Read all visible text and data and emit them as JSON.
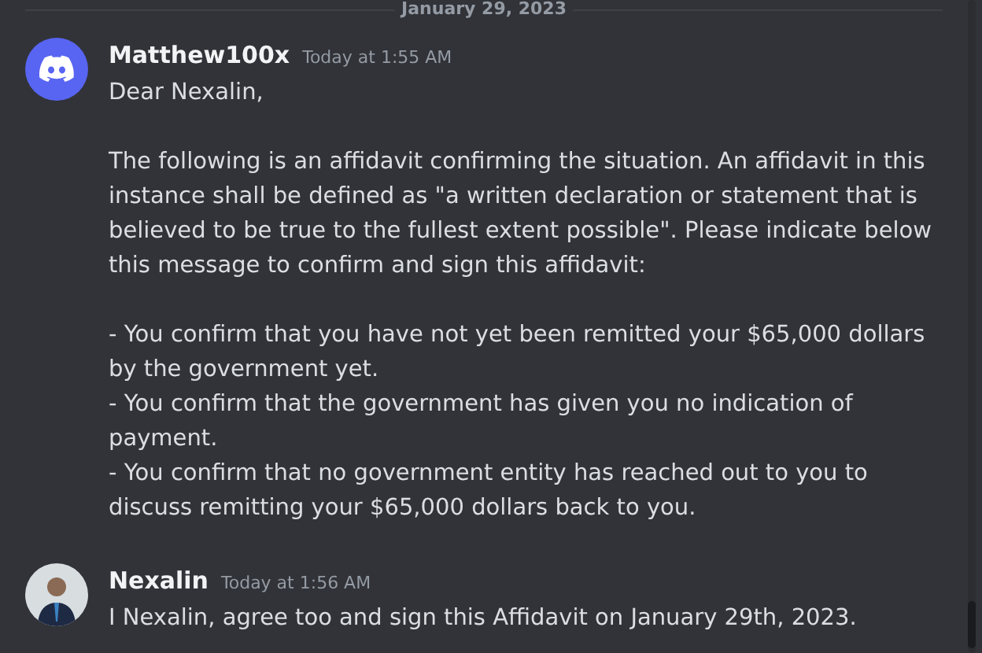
{
  "date_divider": "January 29, 2023",
  "messages": [
    {
      "author": "Matthew100x",
      "timestamp": "Today at 1:55 AM",
      "avatar": {
        "kind": "logo"
      },
      "blocks": [
        [
          "Dear Nexalin,"
        ],
        [
          "The following is an affidavit confirming the situation. An affidavit in this instance shall be defined as \"a written declaration or statement that is believed to be true to the fullest extent possible\". Please indicate below this message to confirm and sign this affidavit:"
        ],
        [
          "- You confirm that you have not yet been remitted your $65,000 dollars by the government yet.",
          "- You confirm that the government has given you no indication of payment.",
          "- You confirm that no government entity has reached out to you to discuss remitting your $65,000 dollars back to you."
        ]
      ]
    },
    {
      "author": "Nexalin",
      "timestamp": "Today at 1:56 AM",
      "avatar": {
        "kind": "photo"
      },
      "blocks": [
        [
          "I Nexalin, agree too and sign this Affidavit on January 29th, 2023."
        ]
      ]
    }
  ]
}
